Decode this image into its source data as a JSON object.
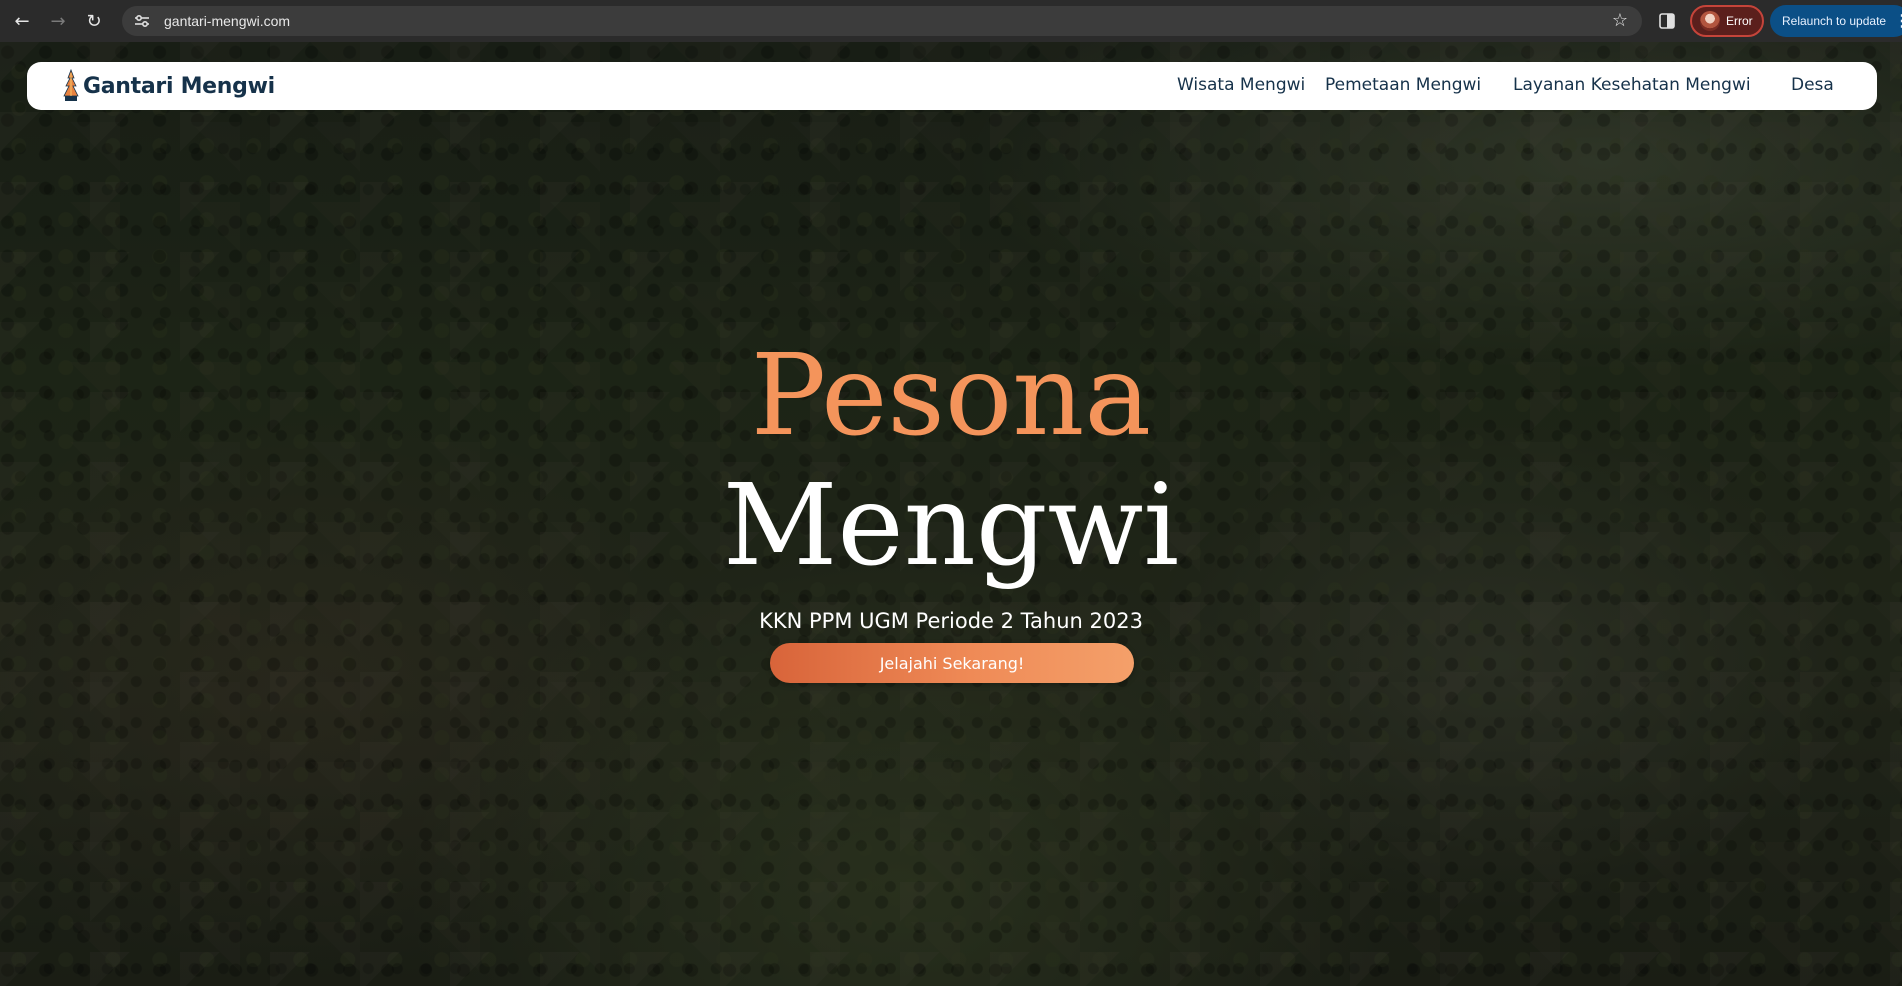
{
  "browser": {
    "url": "gantari-mengwi.com",
    "profile_status": "Error",
    "relaunch_label": "Relaunch to update",
    "icons": {
      "back": "arrow-left-icon",
      "forward": "arrow-right-icon",
      "reload": "reload-icon",
      "site_info": "tune-icon",
      "bookmark": "star-icon",
      "side_panel": "side-panel-icon",
      "menu": "kebab-menu-icon"
    },
    "colors": {
      "profile_error": "#c5443a",
      "relaunch_bg": "#0b4f86"
    }
  },
  "site": {
    "brand": "Gantari Mengwi",
    "nav": [
      {
        "label": "Wisata Mengwi"
      },
      {
        "label": "Pemetaan Mengwi"
      },
      {
        "label": "Layanan Kesehatan Mengwi"
      },
      {
        "label": "Desa"
      }
    ],
    "hero": {
      "title_line1": "Pesona",
      "title_line2": "Mengwi",
      "subtitle": "KKN PPM UGM Periode 2 Tahun 2023",
      "cta": "Jelajahi Sekarang!"
    },
    "colors": {
      "accent": "#f4945b",
      "brand_text": "#16324a"
    }
  }
}
